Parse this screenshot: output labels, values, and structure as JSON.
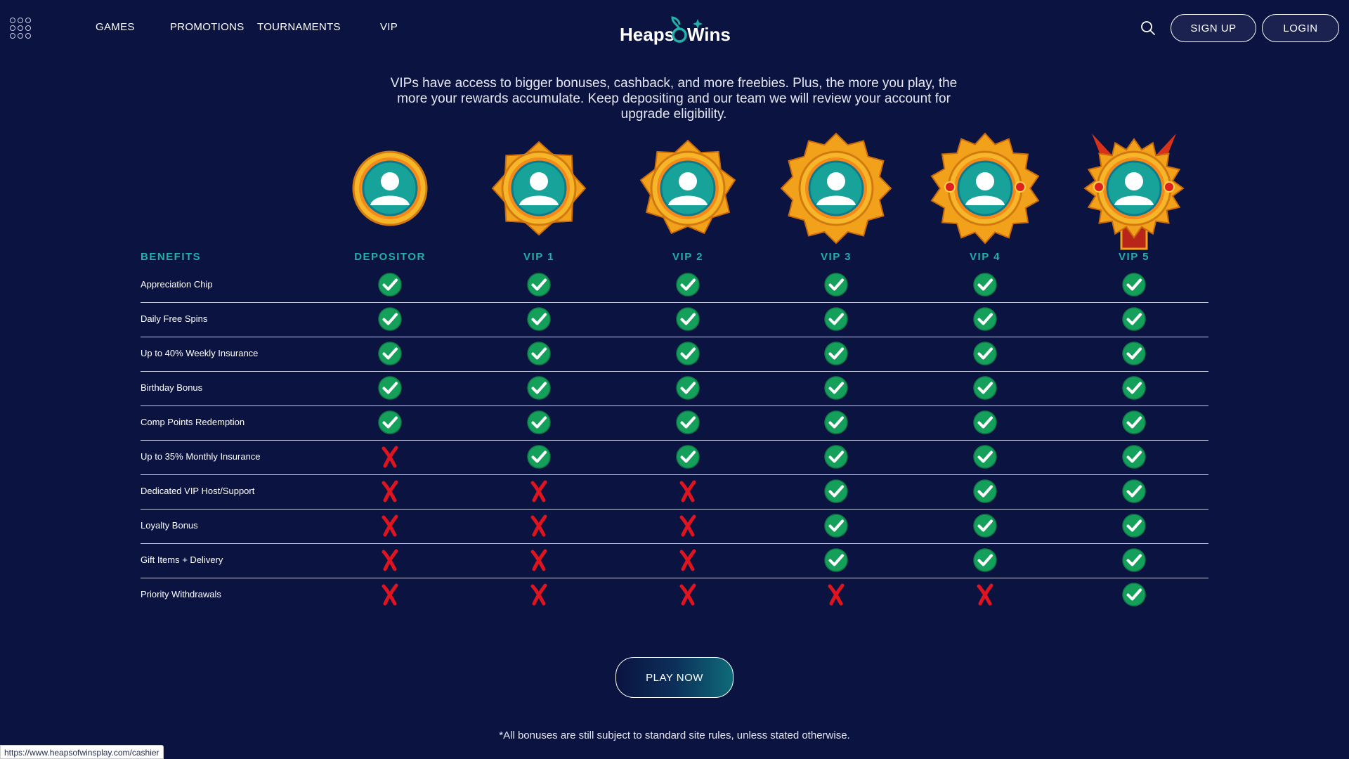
{
  "header": {
    "nav": [
      "GAMES",
      "PROMOTIONS",
      "TOURNAMENTS",
      "VIP"
    ],
    "logo": "Heaps o Wins",
    "signup_label": "SIGN UP",
    "login_label": "LOGIN"
  },
  "intro": "VIPs have access to bigger bonuses, cashback, and more freebies. Plus, the more you play, the more your rewards accumulate. Keep depositing and our team we will review your account for upgrade eligibility.",
  "table": {
    "benefits_header": "BENEFITS",
    "tiers": [
      "DEPOSITOR",
      "VIP 1",
      "VIP 2",
      "VIP 3",
      "VIP 4",
      "VIP 5"
    ],
    "rows": [
      {
        "label": "Appreciation Chip",
        "values": [
          true,
          true,
          true,
          true,
          true,
          true
        ]
      },
      {
        "label": "Daily Free Spins",
        "values": [
          true,
          true,
          true,
          true,
          true,
          true
        ]
      },
      {
        "label": "Up to 40% Weekly Insurance",
        "values": [
          true,
          true,
          true,
          true,
          true,
          true
        ]
      },
      {
        "label": "Birthday Bonus",
        "values": [
          true,
          true,
          true,
          true,
          true,
          true
        ]
      },
      {
        "label": "Comp Points Redemption",
        "values": [
          true,
          true,
          true,
          true,
          true,
          true
        ]
      },
      {
        "label": "Up to 35% Monthly Insurance",
        "values": [
          false,
          true,
          true,
          true,
          true,
          true
        ]
      },
      {
        "label": "Dedicated VIP Host/Support",
        "values": [
          false,
          false,
          false,
          true,
          true,
          true
        ]
      },
      {
        "label": "Loyalty Bonus",
        "values": [
          false,
          false,
          false,
          true,
          true,
          true
        ]
      },
      {
        "label": "Gift Items + Delivery",
        "values": [
          false,
          false,
          false,
          true,
          true,
          true
        ]
      },
      {
        "label": "Priority Withdrawals",
        "values": [
          false,
          false,
          false,
          false,
          false,
          true
        ]
      }
    ]
  },
  "cta": {
    "play_label": "PLAY NOW"
  },
  "footnote": "*All bonuses are still subject to standard site rules, unless stated otherwise.",
  "status_url": "https://www.heapsofwinsplay.com/cashier",
  "colors": {
    "background": "#0b1340",
    "accent_teal": "#22b0a8",
    "check_green": "#14a05a",
    "cross_red": "#e0141e",
    "badge_gold": "#f2a21a"
  }
}
